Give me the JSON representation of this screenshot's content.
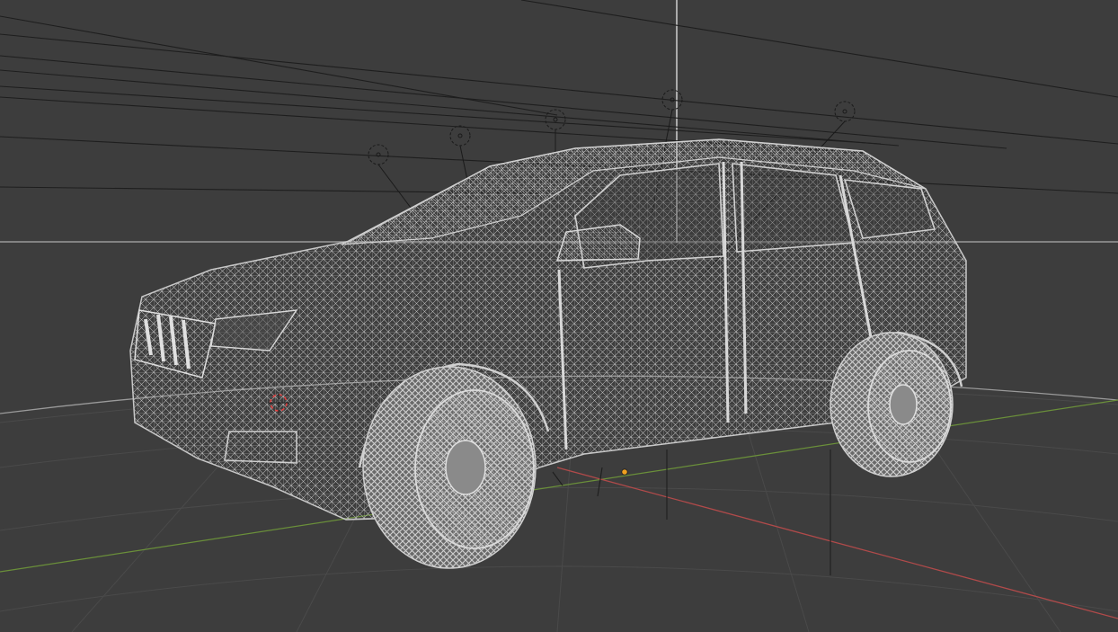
{
  "viewport": {
    "shading_mode": "wireframe",
    "background_color": "#3d3d3d",
    "grid_color": "#4a4a4a",
    "x_axis_color": "#b04a4a",
    "y_axis_color": "#6a8f3a",
    "wire_color": "#c8c8c8",
    "selection_origin_color": "#f0a020",
    "cursor_color": "#e04040"
  },
  "objects": {
    "vehicle": {
      "type": "mesh",
      "icon": "wireframe-suv"
    },
    "lights": {
      "count": 5,
      "icon": "light-icon"
    },
    "cursor_3d": {
      "icon": "3d-cursor-icon"
    },
    "origin": {
      "icon": "origin-dot-icon"
    }
  }
}
